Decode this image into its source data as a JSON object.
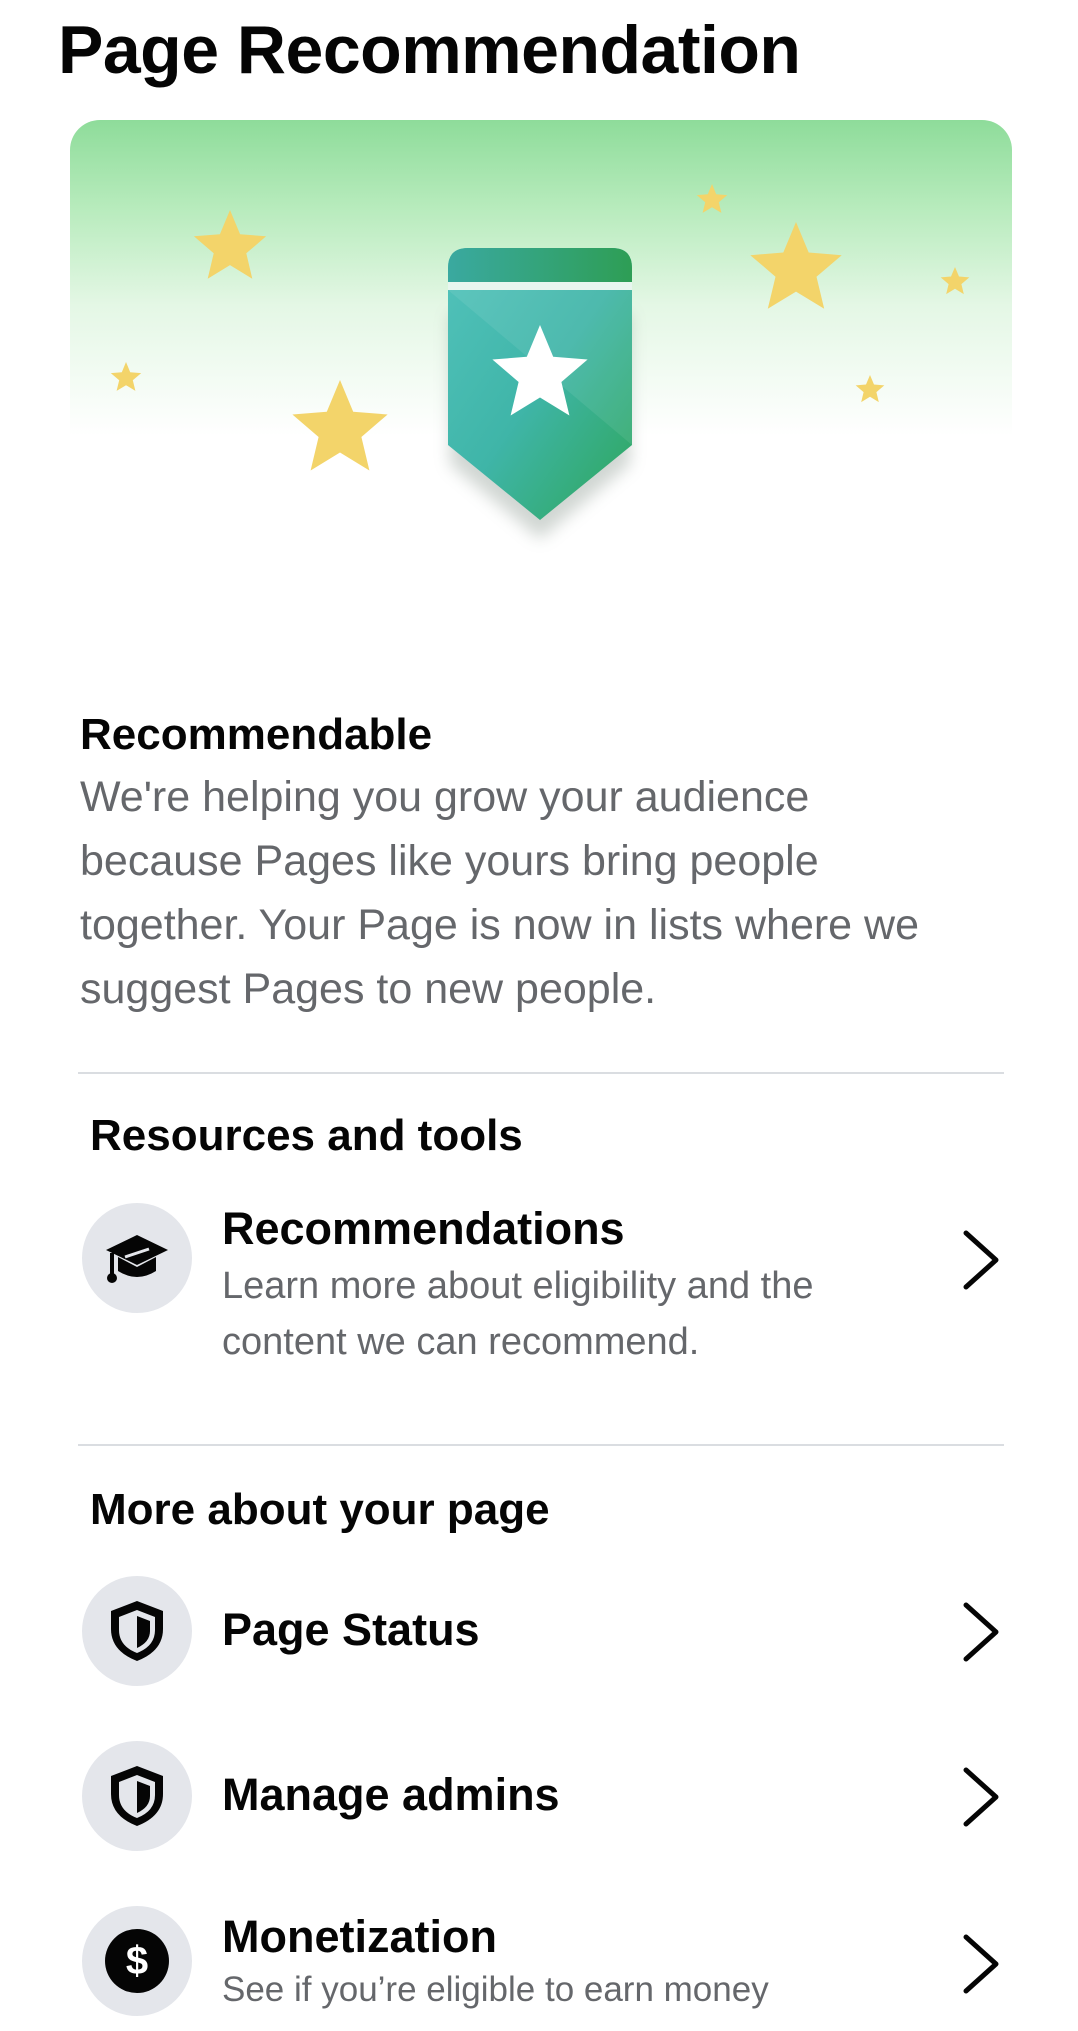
{
  "header": {
    "title": "Page Recommendation"
  },
  "hero": {
    "icon": "star-badge-illustration",
    "colors": {
      "gradient_top": "#8edc9a",
      "badge_teal": "#3fb5a8",
      "badge_green": "#2ea65a",
      "star_yellow": "#f3d46a"
    }
  },
  "status": {
    "heading": "Recommendable",
    "body": "We're helping you grow your audience because Pages like yours bring people together. Your Page is now in lists where we suggest Pages to new people."
  },
  "resources": {
    "title": "Resources and tools",
    "items": [
      {
        "icon": "graduation-cap-icon",
        "title": "Recommendations",
        "subtitle": "Learn more about eligibility and the content we can recommend."
      }
    ]
  },
  "more": {
    "title": "More about your page",
    "items": [
      {
        "icon": "shield-icon",
        "title": "Page Status"
      },
      {
        "icon": "shield-icon",
        "title": "Manage admins"
      },
      {
        "icon": "dollar-icon",
        "title": "Monetization",
        "subtitle": "See if you’re eligible to earn money"
      }
    ]
  },
  "colors": {
    "text_primary": "#050505",
    "text_secondary": "#65676b",
    "icon_bg": "#e4e6eb",
    "divider": "#dadde1"
  }
}
